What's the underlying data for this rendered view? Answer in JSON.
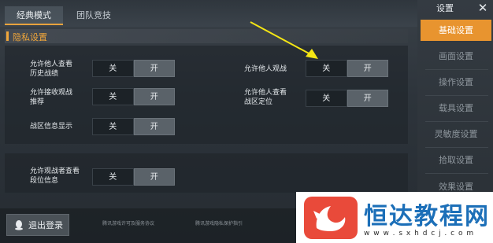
{
  "tabs": [
    {
      "label": "经典模式",
      "active": true
    },
    {
      "label": "团队竞技",
      "active": false
    }
  ],
  "section_title": "隐私设置",
  "toggle_labels": {
    "off": "关",
    "on": "开"
  },
  "settings": [
    {
      "label": "允许他人查看\n历史战绩",
      "selected": "开"
    },
    {
      "label": "允许他人观战",
      "selected": "开"
    },
    {
      "label": "允许接收观战\n推荐",
      "selected": "开"
    },
    {
      "label": "允许他人查看\n战区定位",
      "selected": "开"
    },
    {
      "label": "战区信息显示",
      "selected": "开"
    },
    {
      "label": "允许观战者查看\n段位信息",
      "selected": "开"
    }
  ],
  "sidebar": {
    "title": "设置",
    "close": "✕",
    "items": [
      "基础设置",
      "画面设置",
      "操作设置",
      "载具设置",
      "灵敏度设置",
      "拾取设置",
      "效果设置"
    ],
    "active_index": 0
  },
  "footer": {
    "logout_label": "退出登录",
    "links": [
      "腾讯游戏许可及服务协议",
      "腾讯游戏隐私保护指引"
    ]
  },
  "watermark": {
    "title": "恒达教程网",
    "url": "w w w . s x h d c j . c o m"
  },
  "colors": {
    "accent": "#e8942f",
    "arrow": "#f5e614",
    "watermark_blue": "#1c6fb8"
  }
}
